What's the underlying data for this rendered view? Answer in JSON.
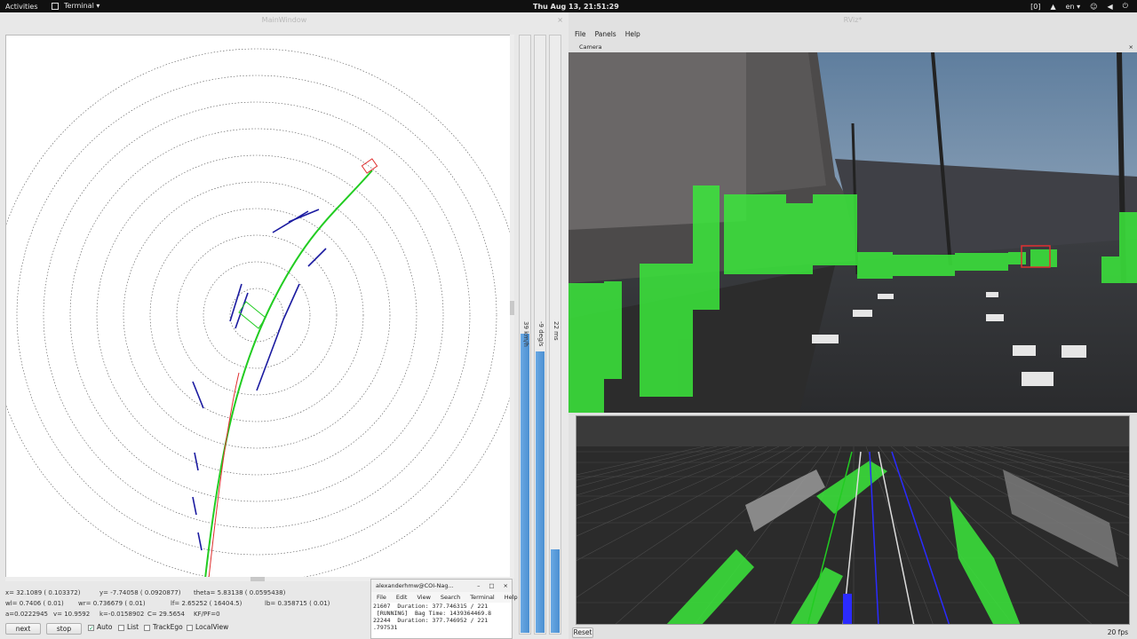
{
  "topbar": {
    "activities": "Activities",
    "app_menu": "Terminal ▾",
    "clock": "Thu Aug 13, 21:51:29",
    "tray": [
      "[0]",
      "en ▾"
    ]
  },
  "main_window": {
    "title": "MainWindow",
    "bars": [
      {
        "label": "39 km/h",
        "fill": 0.5
      },
      {
        "label": "-9 deg/s",
        "fill": 0.47
      },
      {
        "label": "22 ms",
        "fill": 0.14
      }
    ],
    "status": {
      "row1": [
        "x=  32.1089 ( 0.103372)",
        "y=  -7.74058 ( 0.0920877)",
        "theta=  5.83138 ( 0.0595438)"
      ],
      "row2": [
        "wl=  0.7406 (     0.01)",
        "wr=  0.736679 (    0.01)",
        "lf=  2.65252 (  16404.5)",
        "lb=  0.358715 (    0.01)"
      ],
      "row3": [
        "a=0.0222945",
        "v=  10.9592",
        "k=-0.0158902",
        "C=  29.5654",
        "KF/PF=0"
      ]
    },
    "controls": {
      "next": "next",
      "stop": "stop",
      "auto": "Auto",
      "list": "List",
      "track_ego": "TrackEgo",
      "local_view": "LocalView"
    }
  },
  "terminal": {
    "title": "alexanderhmw@COI-Nag...",
    "menu": [
      "File",
      "Edit",
      "View",
      "Search",
      "Terminal",
      "Help"
    ],
    "lines": [
      "21607  Duration: 377.746315 / 221",
      " [RUNNING]  Bag Time: 1439364469.8",
      "22244  Duration: 377.746952 / 221",
      ".797531"
    ]
  },
  "rviz": {
    "title": "RViz*",
    "menu": [
      "File",
      "Panels",
      "Help"
    ],
    "camera_label": "Camera",
    "reset": "Reset",
    "fps": "20 fps"
  },
  "colors": {
    "track": "#22cc22",
    "scan": "#1a1aa0",
    "target": "#e03030",
    "bar_fill": "#4b8fd1",
    "overlay": "#3be83b"
  }
}
